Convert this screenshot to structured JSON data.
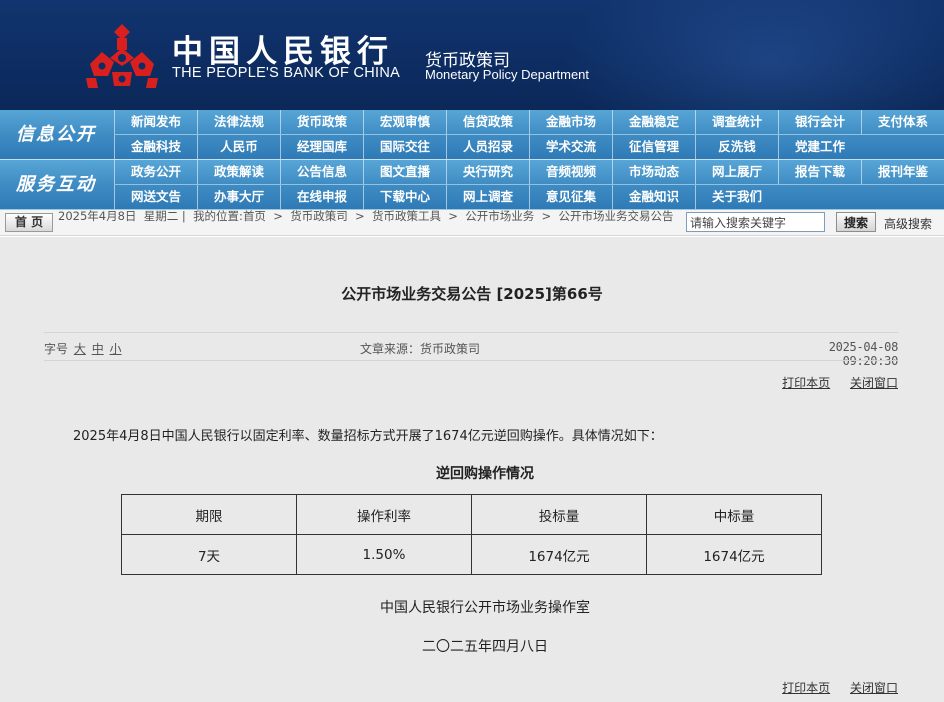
{
  "header": {
    "bank_name_cn": "中国人民银行",
    "bank_name_en": "THE PEOPLE'S BANK OF CHINA",
    "dept_cn": "货币政策司",
    "dept_en": "Monetary Policy Department",
    "logo_icon": "pboc-emblem-icon",
    "colors": {
      "banner": "#0d2d63",
      "logo": "#d9201f",
      "nav": "#3f8cc4"
    }
  },
  "nav": {
    "info_title": "信息公开",
    "info_row1": [
      "新闻发布",
      "法律法规",
      "货币政策",
      "宏观审慎",
      "信贷政策",
      "金融市场",
      "金融稳定",
      "调查统计",
      "银行会计",
      "支付体系"
    ],
    "info_row2": [
      "金融科技",
      "人民币",
      "经理国库",
      "国际交往",
      "人员招录",
      "学术交流",
      "征信管理",
      "反洗钱",
      "党建工作"
    ],
    "service_title": "服务互动",
    "service_row1": [
      "政务公开",
      "政策解读",
      "公告信息",
      "图文直播",
      "央行研究",
      "音频视频",
      "市场动态",
      "网上展厅",
      "报告下载",
      "报刊年鉴"
    ],
    "service_row2": [
      "网送文告",
      "办事大厅",
      "在线申报",
      "下载中心",
      "网上调查",
      "意见征集",
      "金融知识",
      "关于我们"
    ]
  },
  "breadcrumb": {
    "home_label": "首 页",
    "date": "2025年4月8日",
    "weekday": "星期二",
    "location_label": "我的位置:",
    "path": [
      "首页",
      "货币政策司",
      "货币政策工具",
      "公开市场业务",
      "公开市场业务交易公告"
    ],
    "separator": ">",
    "search_placeholder": "请输入搜索关键字",
    "search_button": "搜索",
    "advanced_search": "高级搜索"
  },
  "article": {
    "title": "公开市场业务交易公告 [2025]第66号",
    "font_size_label": "字号",
    "font_sizes": [
      "大",
      "中",
      "小"
    ],
    "source": "文章来源：货币政策司",
    "datetime": "2025-04-08 09:20:30",
    "print_label": "打印本页",
    "close_label": "关闭窗口",
    "body": "2025年4月8日中国人民银行以固定利率、数量招标方式开展了1674亿元逆回购操作。具体情况如下：",
    "table_caption": "逆回购操作情况",
    "table": {
      "headers": [
        "期限",
        "操作利率",
        "投标量",
        "中标量"
      ],
      "rows": [
        [
          "7天",
          "1.50%",
          "1674亿元",
          "1674亿元"
        ]
      ]
    },
    "signature_office": "中国人民银行公开市场业务操作室",
    "signature_date": "二〇二五年四月八日"
  }
}
